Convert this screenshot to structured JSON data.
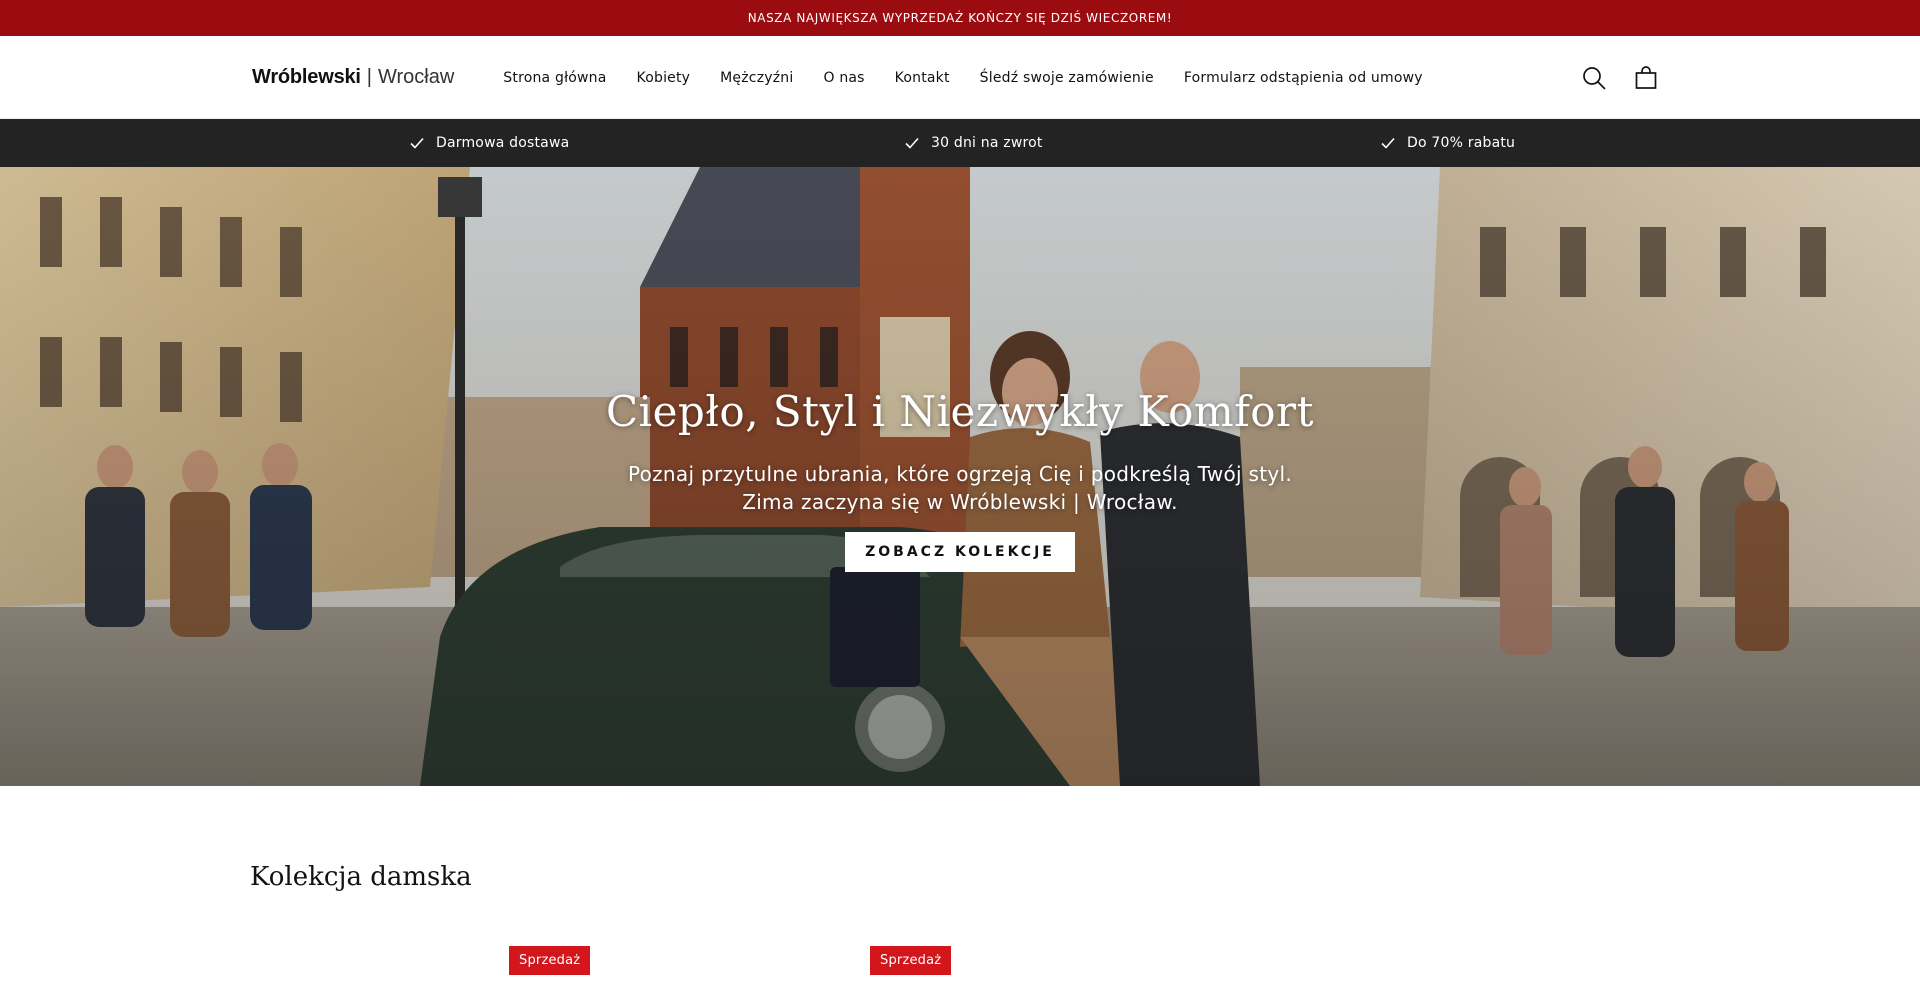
{
  "announcement": {
    "text": "NASZA NAJWIĘKSZA WYPRZEDAŻ KOŃCZY SIĘ DZIŚ WIECZOREM!"
  },
  "header": {
    "logo": {
      "brand": "Wróblewski",
      "separator": "|",
      "city": "Wrocław"
    },
    "nav": [
      {
        "label": "Strona główna"
      },
      {
        "label": "Kobiety"
      },
      {
        "label": "Mężczyźni"
      },
      {
        "label": "O nas"
      },
      {
        "label": "Kontakt"
      },
      {
        "label": "Śledź swoje zamówienie"
      },
      {
        "label": "Formularz odstąpienia od umowy"
      }
    ],
    "icons": [
      "search-icon",
      "cart-icon"
    ]
  },
  "benefits": [
    {
      "icon": "check-icon",
      "label": "Darmowa dostawa"
    },
    {
      "icon": "check-icon",
      "label": "30 dni na zwrot"
    },
    {
      "icon": "check-icon",
      "label": "Do 70% rabatu"
    }
  ],
  "hero": {
    "title": "Ciepło, Styl i Niezwykły Komfort",
    "subtitle_line1": "Poznaj przytulne ubrania, które ogrzeją Cię i podkreślą Twój styl.",
    "subtitle_line2": "Zima zaczyna się w Wróblewski | Wrocław.",
    "button_label": "ZOBACZ KOLEKCJE"
  },
  "collection": {
    "title": "Kolekcja damska",
    "badges": [
      {
        "label": "Sprzedaż"
      },
      {
        "label": "Sprzedaż"
      }
    ]
  },
  "colors": {
    "announcement_bg": "#9b0c10",
    "benefits_bg": "#232323",
    "badge_bg": "#d2161c",
    "text": "#121212"
  }
}
